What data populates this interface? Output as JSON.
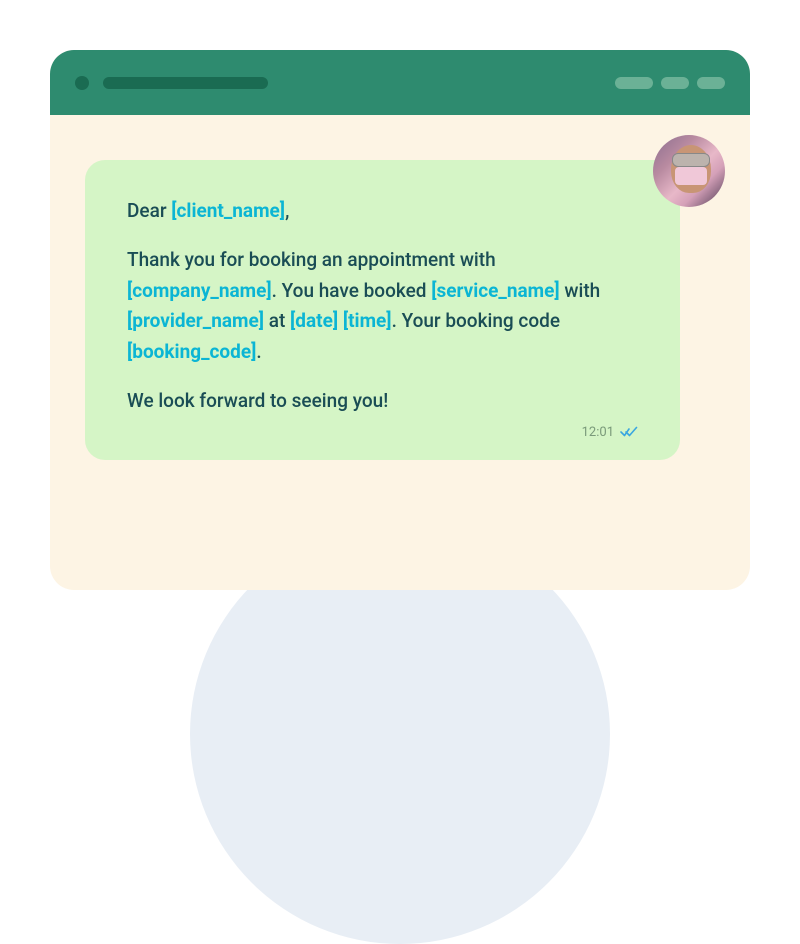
{
  "message": {
    "greeting_prefix": "Dear ",
    "greeting_suffix": ",",
    "placeholders": {
      "client_name": "[client_name]",
      "company_name": "[company_name]",
      "service_name": "[service_name]",
      "provider_name": "[provider_name]",
      "date": "[date]",
      "time": "[time]",
      "booking_code": "[booking_code]"
    },
    "body": {
      "line1_a": "Thank you for booking an appointment with ",
      "line1_b": ".  You have booked ",
      "line1_c": " with ",
      "line1_d": " at ",
      "line1_e": " ",
      "line1_f": ". Your booking code ",
      "line1_g": "."
    },
    "closing": "We look forward to seeing you!",
    "timestamp": "12:01"
  }
}
